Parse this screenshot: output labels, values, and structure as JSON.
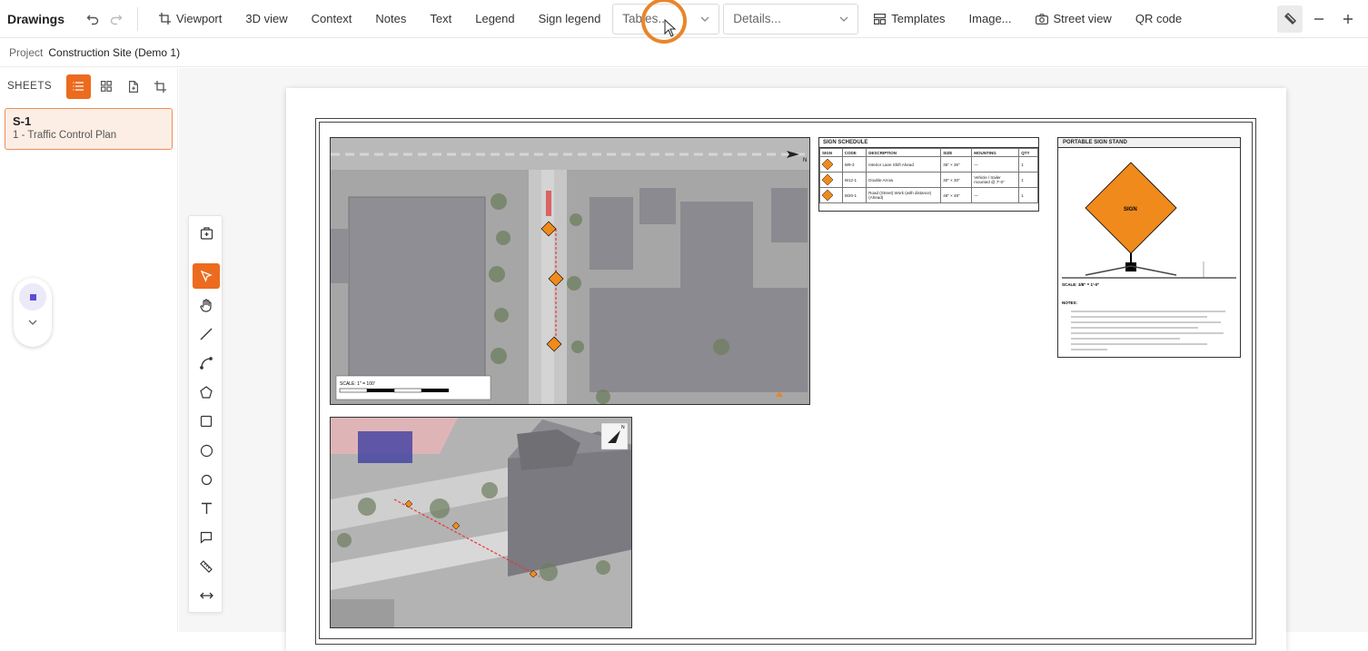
{
  "app": {
    "title": "Drawings"
  },
  "toolbar": {
    "viewport": "Viewport",
    "view3d": "3D view",
    "context": "Context",
    "notes": "Notes",
    "text": "Text",
    "legend": "Legend",
    "sign_legend": "Sign legend",
    "tables_placeholder": "Tables...",
    "details_placeholder": "Details...",
    "templates": "Templates",
    "image": "Image...",
    "street_view": "Street view",
    "qr_code": "QR code"
  },
  "project": {
    "label": "Project",
    "name": "Construction Site (Demo 1)"
  },
  "sidebar": {
    "sheets_title": "SHEETS",
    "sheets": [
      {
        "code": "S-1",
        "name": "1 - Traffic Control Plan"
      }
    ]
  },
  "drawing": {
    "sign_schedule": {
      "title": "SIGN SCHEDULE",
      "headers": [
        "SIGN",
        "CODE",
        "DESCRIPTION",
        "SIZE",
        "MOUNTING",
        "QTY"
      ],
      "rows": [
        {
          "code": "W9-3",
          "description": "Interior Lane Shift Ahead",
          "size": "36\" × 36\"",
          "mounting": "—",
          "qty": "1"
        },
        {
          "code": "W12-1",
          "description": "Double Arrow",
          "size": "30\" × 30\"",
          "mounting": "Vehicle / trailer mounted @ 7'-0\"",
          "qty": "1"
        },
        {
          "code": "W20-1",
          "description": "Road (Street) Work (with distance) (Ahead)",
          "size": "48\" × 48\"",
          "mounting": "—",
          "qty": "1"
        }
      ]
    },
    "portable_stand": {
      "title": "PORTABLE SIGN STAND",
      "sign_label": "SIGN",
      "scale": "SCALE: 3/8\" = 1'-0\"",
      "notes_title": "NOTES:"
    },
    "aerial": {
      "scale": "SCALE: 1\" = 100'",
      "north": "N"
    },
    "iso": {
      "north": "N"
    }
  },
  "colors": {
    "accent": "#ec6b1f",
    "sign": "#f08a1c"
  }
}
